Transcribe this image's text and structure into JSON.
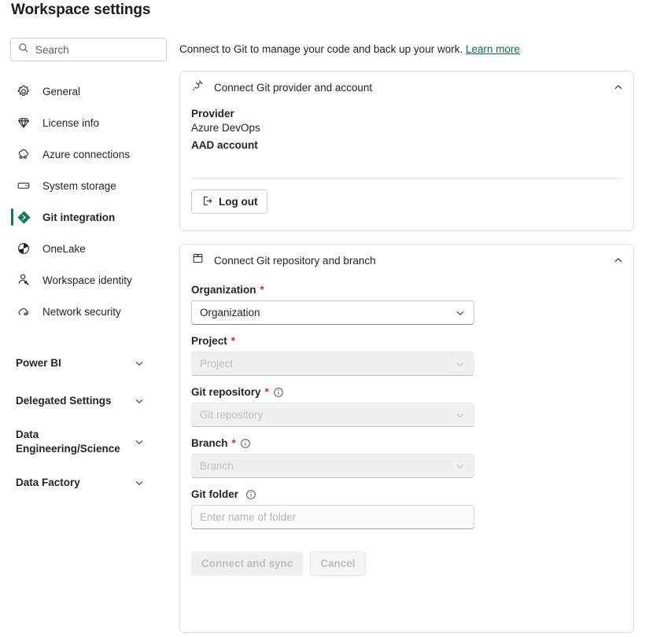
{
  "page_title": "Workspace settings",
  "search": {
    "placeholder": "Search",
    "icon": "search-icon"
  },
  "sidebar": {
    "items": [
      {
        "label": "General",
        "icon": "gear-icon",
        "selected": false
      },
      {
        "label": "License info",
        "icon": "gem-icon",
        "selected": false
      },
      {
        "label": "Azure connections",
        "icon": "cloud-link-icon",
        "selected": false
      },
      {
        "label": "System storage",
        "icon": "storage-drive-icon",
        "selected": false
      },
      {
        "label": "Git integration",
        "icon": "git-diamond-icon",
        "selected": true
      },
      {
        "label": "OneLake",
        "icon": "onelake-icon",
        "selected": false
      },
      {
        "label": "Workspace identity",
        "icon": "person-key-icon",
        "selected": false
      },
      {
        "label": "Network security",
        "icon": "cloud-shield-icon",
        "selected": false
      }
    ],
    "groups": [
      {
        "label": "Power BI",
        "icon": "chevron-down-icon",
        "two_line": false
      },
      {
        "label": "Delegated Settings",
        "icon": "chevron-down-icon",
        "two_line": false
      },
      {
        "label": "Data Engineering/Science",
        "icon": "chevron-down-icon",
        "two_line": true
      },
      {
        "label": "Data Factory",
        "icon": "chevron-down-icon",
        "two_line": false
      }
    ]
  },
  "main": {
    "description": "Connect to Git to manage your code and back up your work.",
    "learn_more": "Learn more",
    "provider_card": {
      "title": "Connect Git provider and account",
      "icon": "plug-connector-icon",
      "collapse_icon": "chevron-up-icon",
      "provider_label": "Provider",
      "provider_value": "Azure DevOps",
      "account_label": "AAD account",
      "logout_label": "Log out",
      "logout_icon": "sign-out-icon"
    },
    "repo_card": {
      "title": "Connect Git repository and branch",
      "icon": "repository-box-icon",
      "collapse_icon": "chevron-up-icon",
      "fields": [
        {
          "label": "Organization",
          "required": true,
          "info": false,
          "placeholder": "Organization",
          "state": "enabled",
          "type": "dropdown"
        },
        {
          "label": "Project",
          "required": true,
          "info": false,
          "placeholder": "Project",
          "state": "disabled",
          "type": "dropdown"
        },
        {
          "label": "Git repository",
          "required": true,
          "info": true,
          "placeholder": "Git repository",
          "state": "disabled",
          "type": "dropdown"
        },
        {
          "label": "Branch",
          "required": true,
          "info": true,
          "placeholder": "Branch",
          "state": "disabled",
          "type": "dropdown"
        },
        {
          "label": "Git folder",
          "required": false,
          "info": true,
          "placeholder": "Enter name of folder",
          "state": "text",
          "type": "text"
        }
      ],
      "primary_button": "Connect and sync",
      "secondary_button": "Cancel"
    }
  },
  "colors": {
    "accent_green": "#107c56",
    "link_green": "#0f6e47",
    "required_red": "#c4314b",
    "border": "#e0e0e0",
    "disabled_bg": "#f0f0f0"
  }
}
